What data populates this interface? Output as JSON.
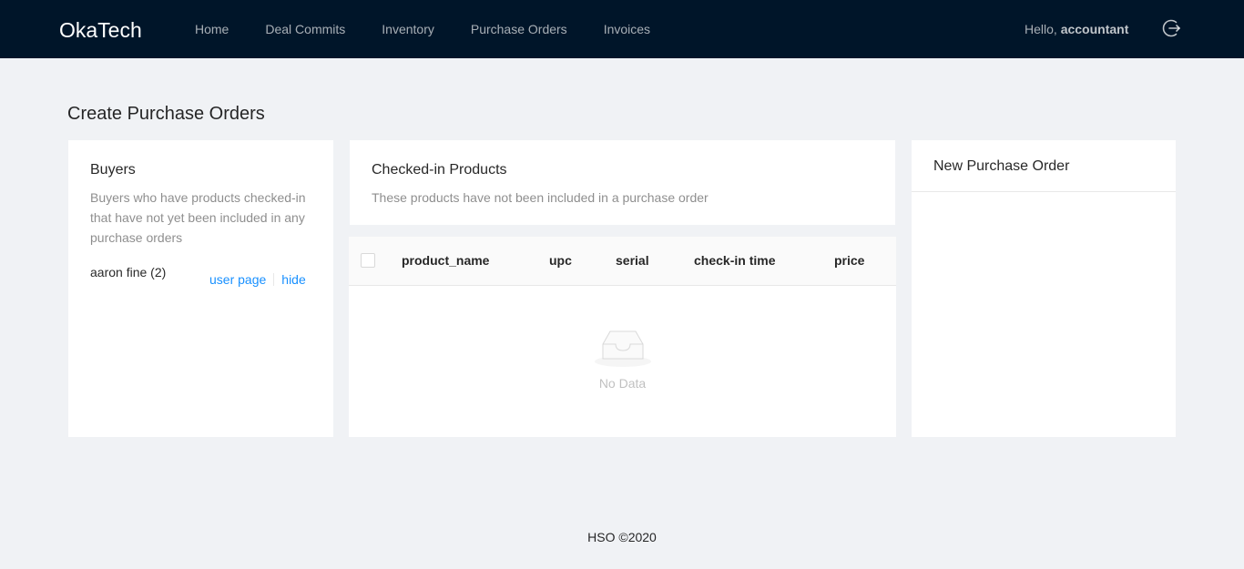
{
  "app": {
    "brand": "OkaTech",
    "nav": [
      {
        "label": "Home"
      },
      {
        "label": "Deal Commits"
      },
      {
        "label": "Inventory"
      },
      {
        "label": "Purchase Orders"
      },
      {
        "label": "Invoices"
      }
    ],
    "greeting_prefix": "Hello, ",
    "username": "accountant",
    "logout_icon": "logout-icon"
  },
  "page": {
    "title": "Create Purchase Orders"
  },
  "buyers": {
    "title": "Buyers",
    "description": "Buyers who have products checked-in that have not yet been included in any purchase orders",
    "items": [
      {
        "name": "aaron fine (2)",
        "user_page_label": "user page",
        "hide_label": "hide"
      }
    ]
  },
  "checked_in": {
    "title": "Checked-in Products",
    "description": "These products have not been included in a purchase order",
    "columns": [
      "product_name",
      "upc",
      "serial",
      "check-in time",
      "price"
    ],
    "empty_text": "No Data"
  },
  "new_po": {
    "title": "New Purchase Order"
  },
  "footer": {
    "text": "HSO ©2020"
  },
  "colors": {
    "header_bg": "#001529",
    "page_bg": "#f0f2f5",
    "link": "#1890ff"
  }
}
